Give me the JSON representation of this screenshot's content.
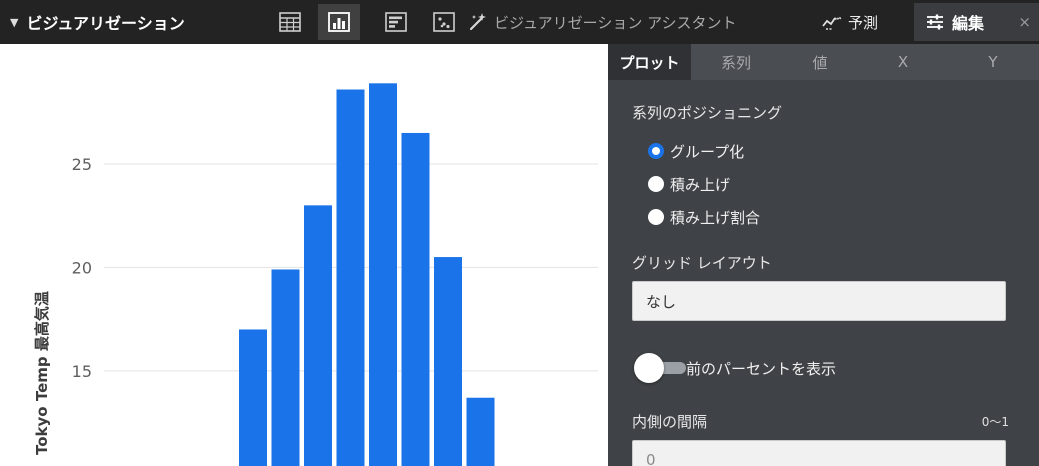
{
  "toolbar": {
    "title": "ビジュアリゼーション",
    "assistant_label": "ビジュアリゼーション アシスタント",
    "forecast_label": "予測",
    "edit_label": "編集",
    "close_label": "×"
  },
  "panel": {
    "tabs": [
      {
        "label": "プロット"
      },
      {
        "label": "系列"
      },
      {
        "label": "値"
      },
      {
        "label": "X"
      },
      {
        "label": "Y"
      }
    ],
    "positioning_label": "系列のポジショニング",
    "positioning_options": [
      {
        "label": "グループ化",
        "checked": true
      },
      {
        "label": "積み上げ",
        "checked": false
      },
      {
        "label": "積み上げ割合",
        "checked": false
      }
    ],
    "grid_layout_label": "グリッド レイアウト",
    "grid_layout_value": "なし",
    "toggle_label": "前のパーセントを表示",
    "toggle_on": false,
    "inner_spacing_label": "内側の間隔",
    "inner_spacing_range": "0〜1",
    "inner_spacing_value": "0"
  },
  "chart_data": {
    "type": "bar",
    "ylabel": "Tokyo Temp 最高気温",
    "yticks": [
      15,
      20,
      25
    ],
    "ylim": [
      10.4,
      30.8
    ],
    "grid": true,
    "bar_color": "#1a73e8",
    "values": [
      17.0,
      19.9,
      23.0,
      28.6,
      28.9,
      26.5,
      20.5,
      13.7
    ]
  }
}
